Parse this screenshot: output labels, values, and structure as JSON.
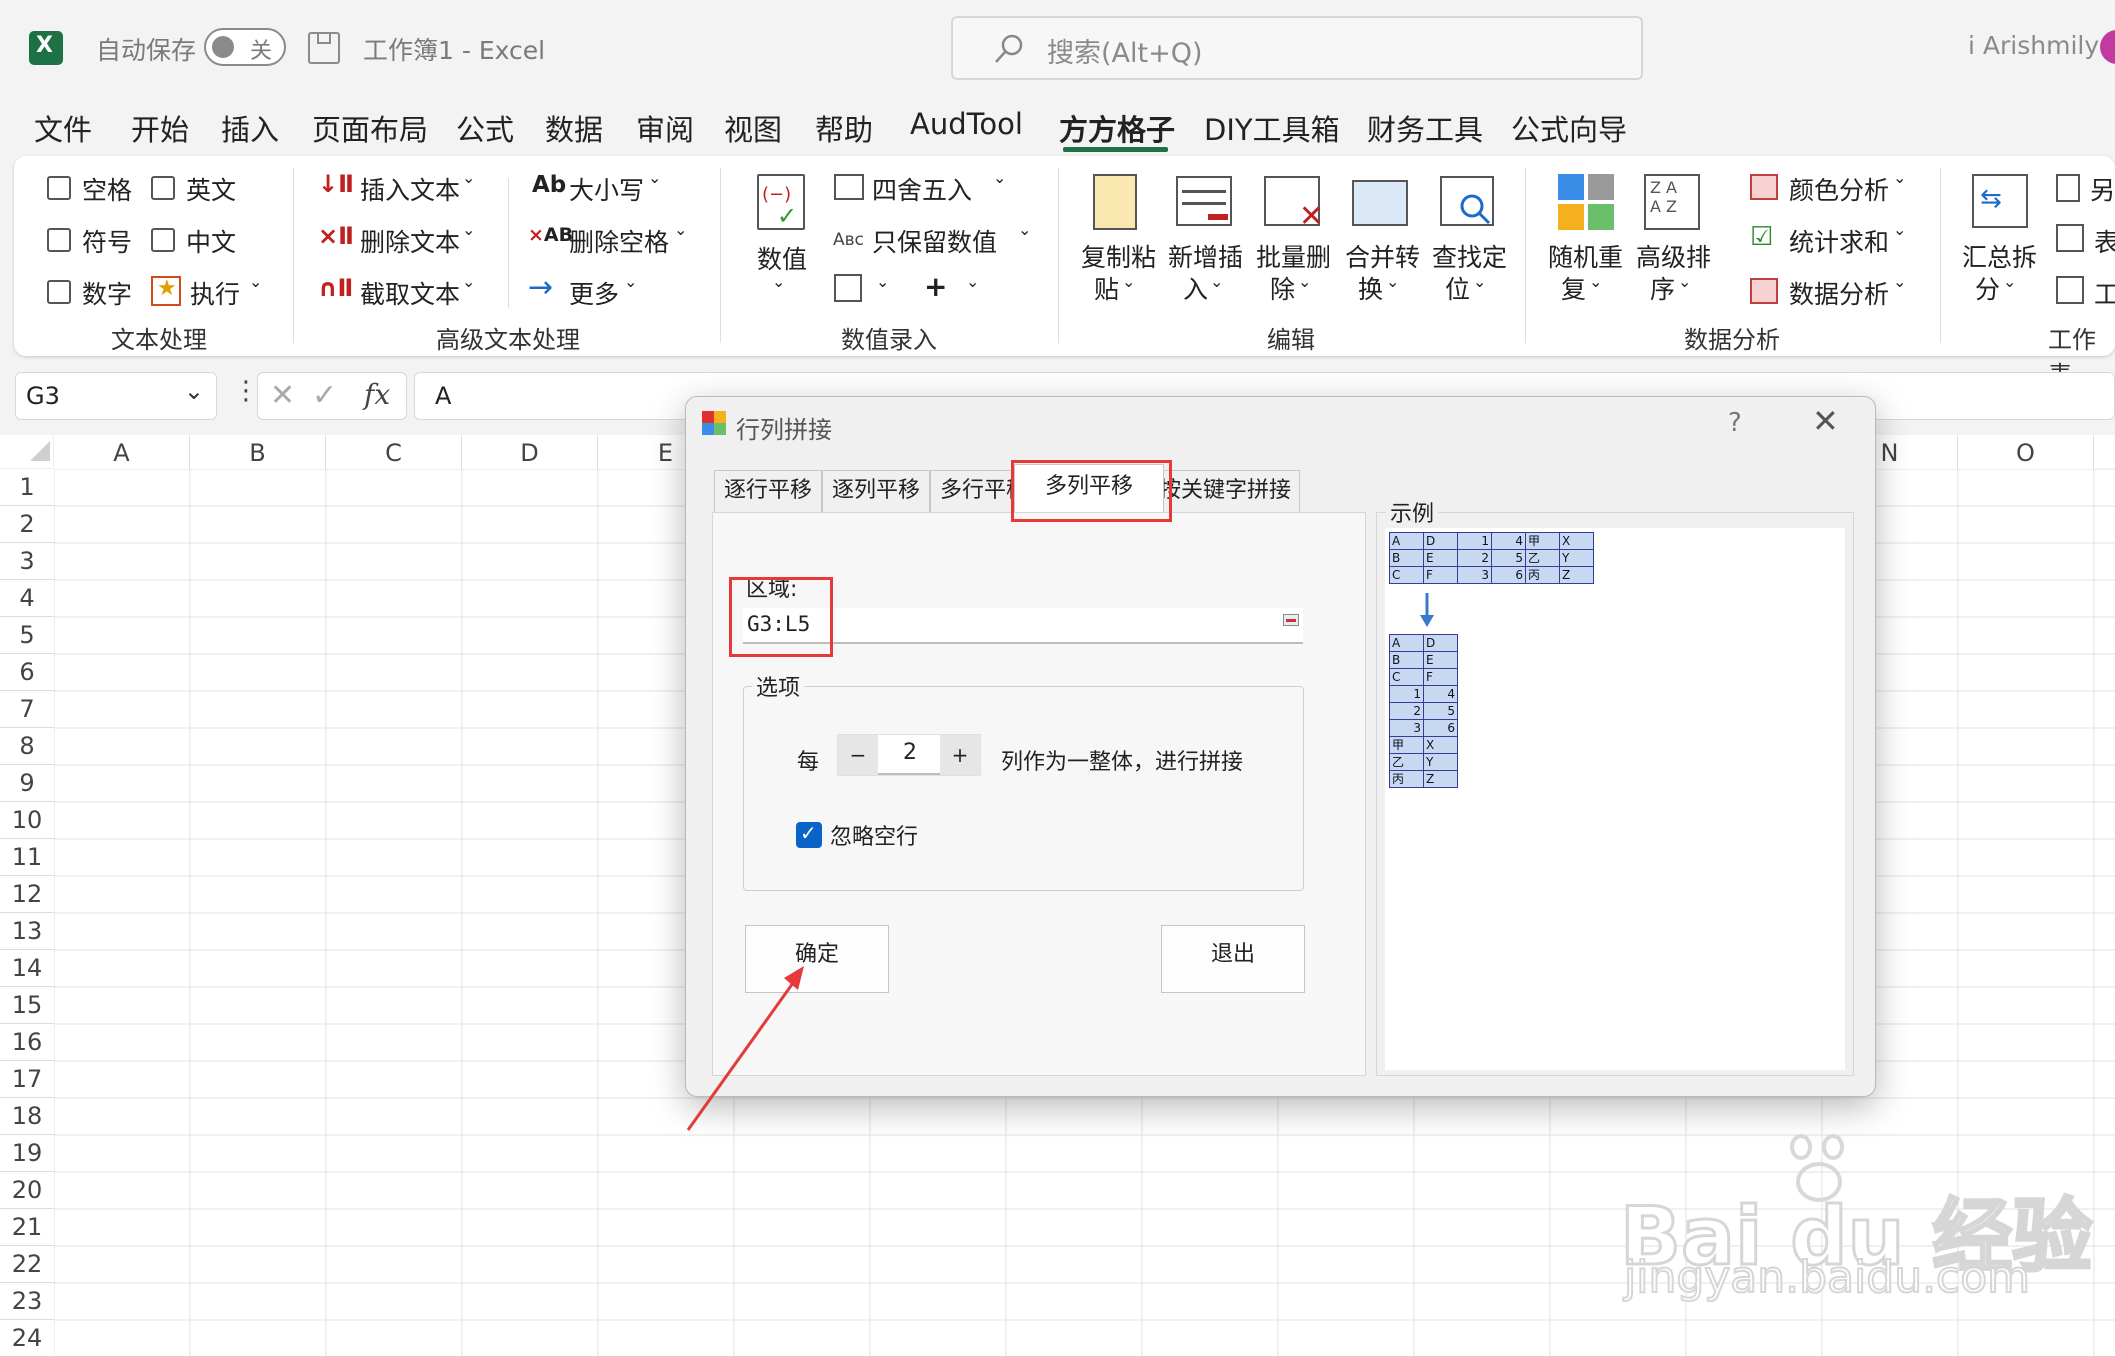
{
  "titlebar": {
    "autosave_label": "自动保存",
    "autosave_state": "关",
    "document_title": "工作簿1  -  Excel",
    "search_placeholder": "搜索(Alt+Q)",
    "user_name": "i Arishmily"
  },
  "menu": [
    "文件",
    "开始",
    "插入",
    "页面布局",
    "公式",
    "数据",
    "审阅",
    "视图",
    "帮助",
    "AudTool",
    "方方格子",
    "DIY工具箱",
    "财务工具",
    "公式向导"
  ],
  "menu_active": "方方格子",
  "ribbon": {
    "text_processing": {
      "checks": [
        "空格",
        "英文",
        "符号",
        "中文",
        "数字"
      ],
      "execute": "执行",
      "group": "文本处理"
    },
    "advanced_text": {
      "insert": "插入文本",
      "delete": "删除文本",
      "extract": "截取文本",
      "case": "大小写",
      "delete_space": "删除空格",
      "more": "更多",
      "group": "高级文本处理"
    },
    "numeric": {
      "value": "数值",
      "round": "四舍五入",
      "keep_value": "只保留数值",
      "plus": "+",
      "group": "数值录入"
    },
    "edit": {
      "copy_paste": [
        "复制粘",
        "贴"
      ],
      "add_insert": [
        "新增插",
        "入"
      ],
      "batch_delete": [
        "批量删",
        "除"
      ],
      "merge_convert": [
        "合并转",
        "换"
      ],
      "find_locate": [
        "查找定",
        "位"
      ],
      "group": "编辑"
    },
    "analysis": {
      "random_repeat": [
        "随机重",
        "复"
      ],
      "advanced_sort": [
        "高级排",
        "序"
      ],
      "color_analysis": "颜色分析",
      "stat_sum": "统计求和",
      "data_analysis": "数据分析",
      "group": "数据分析"
    },
    "worksheet": {
      "summary_split": [
        "汇总拆",
        "分"
      ],
      "item1": "另",
      "item2": "表",
      "item3": "工",
      "group": "工作表"
    }
  },
  "formula_bar": {
    "name_box": "G3",
    "fx": "fx",
    "content": "A"
  },
  "columns": [
    "A",
    "B",
    "C",
    "D",
    "E",
    "N",
    "O"
  ],
  "rows": [
    "1",
    "2",
    "3",
    "4",
    "5",
    "6",
    "7",
    "8",
    "9",
    "10",
    "11",
    "12",
    "13",
    "14",
    "15",
    "16",
    "17",
    "18",
    "19",
    "20",
    "21",
    "22",
    "23",
    "24"
  ],
  "dialog": {
    "title": "行列拼接",
    "help": "?",
    "tabs": [
      "逐行平移",
      "逐列平移",
      "多行平移",
      "多列平移",
      "按关键字拼接"
    ],
    "active_tab": "多列平移",
    "area_label": "区域:",
    "area_value": "G3:L5",
    "options_label": "选项",
    "every": "每",
    "minus": "−",
    "count": "2",
    "plus": "+",
    "suffix": "列作为一整体，进行拼接",
    "ignore_empty": "忽略空行",
    "ignore_empty_checked": true,
    "ok": "确定",
    "exit": "退出",
    "example_label": "示例",
    "example_top": [
      [
        "A",
        "D",
        "1",
        "4",
        "甲",
        "X"
      ],
      [
        "B",
        "E",
        "2",
        "5",
        "乙",
        "Y"
      ],
      [
        "C",
        "F",
        "3",
        "6",
        "丙",
        "Z"
      ]
    ],
    "example_bottom": [
      [
        "A",
        "D"
      ],
      [
        "B",
        "E"
      ],
      [
        "C",
        "F"
      ],
      [
        "1",
        "4"
      ],
      [
        "2",
        "5"
      ],
      [
        "3",
        "6"
      ],
      [
        "甲",
        "X"
      ],
      [
        "乙",
        "Y"
      ],
      [
        "丙",
        "Z"
      ]
    ]
  },
  "watermark": {
    "brand": "Bai du 经验",
    "url": "jingyan.baidu.com"
  },
  "colors": {
    "excel_green": "#1e7145",
    "accent_red": "#e43a3a",
    "checkbox_blue": "#0a64c8",
    "example_fill": "#c7d9f1"
  }
}
